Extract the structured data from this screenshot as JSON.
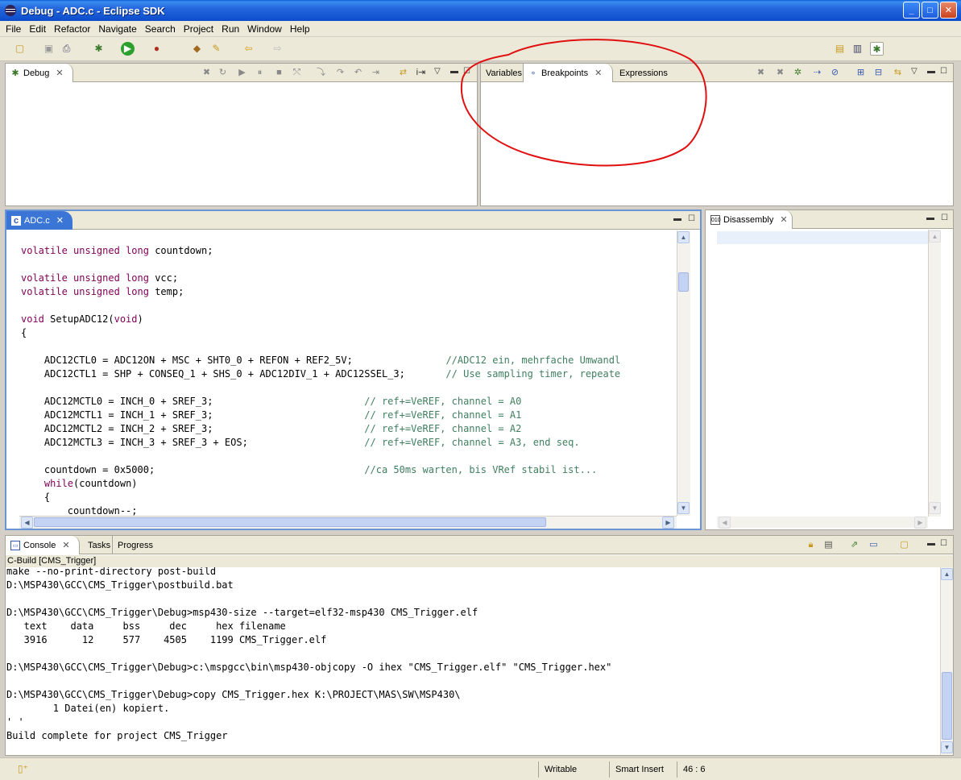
{
  "window": {
    "title": "Debug - ADC.c - Eclipse SDK"
  },
  "menu": [
    "File",
    "Edit",
    "Refactor",
    "Navigate",
    "Search",
    "Project",
    "Run",
    "Window",
    "Help"
  ],
  "debug_view": {
    "tab_label": "Debug"
  },
  "variables_view": {
    "tabs": [
      "Variables",
      "Breakpoints",
      "Expressions"
    ]
  },
  "editor": {
    "tab_label": "ADC.c",
    "lines": [
      "",
      "volatile unsigned long countdown;",
      "",
      "volatile unsigned long vcc;",
      "volatile unsigned long temp;",
      "",
      "void SetupADC12(void)",
      "{",
      "",
      "    ADC12CTL0 = ADC12ON + MSC + SHT0_0 + REFON + REF2_5V;                //ADC12 ein, mehrfache Umwandl",
      "    ADC12CTL1 = SHP + CONSEQ_1 + SHS_0 + ADC12DIV_1 + ADC12SSEL_3;       // Use sampling timer, repeate",
      "",
      "    ADC12MCTL0 = INCH_0 + SREF_3;                          // ref+=VeREF, channel = A0",
      "    ADC12MCTL1 = INCH_1 + SREF_3;                          // ref+=VeREF, channel = A1",
      "    ADC12MCTL2 = INCH_2 + SREF_3;                          // ref+=VeREF, channel = A2",
      "    ADC12MCTL3 = INCH_3 + SREF_3 + EOS;                    // ref+=VeREF, channel = A3, end seq.",
      "",
      "    countdown = 0x5000;                                    //ca 50ms warten, bis VRef stabil ist...",
      "    while(countdown)",
      "    {",
      "        countdown--;"
    ]
  },
  "disassembly_view": {
    "tab_label": "Disassembly"
  },
  "console_view": {
    "tabs": [
      "Console",
      "Tasks",
      "Progress"
    ],
    "subtitle": "C-Build [CMS_Trigger]",
    "lines": [
      "make --no-print-directory post-build",
      "D:\\MSP430\\GCC\\CMS_Trigger\\postbuild.bat",
      "",
      "D:\\MSP430\\GCC\\CMS_Trigger\\Debug>msp430-size --target=elf32-msp430 CMS_Trigger.elf",
      "   text    data     bss     dec     hex filename",
      "   3916      12     577    4505    1199 CMS_Trigger.elf",
      "",
      "D:\\MSP430\\GCC\\CMS_Trigger\\Debug>c:\\mspgcc\\bin\\msp430-objcopy -O ihex \"CMS_Trigger.elf\" \"CMS_Trigger.hex\"",
      "",
      "D:\\MSP430\\GCC\\CMS_Trigger\\Debug>copy CMS_Trigger.hex K:\\PROJECT\\MAS\\SW\\MSP430\\",
      "        1 Datei(en) kopiert.",
      "' '",
      "Build complete for project CMS_Trigger"
    ]
  },
  "status": {
    "writable": "Writable",
    "insert_mode": "Smart Insert",
    "position": "46 : 6"
  },
  "colors": {
    "title_bar": "#0c4ccc",
    "annotation_circle": "#e01010",
    "keyword": "#7f0055",
    "comment": "#3f7f5f"
  }
}
